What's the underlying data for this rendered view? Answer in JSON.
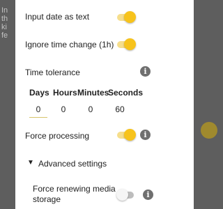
{
  "background": {
    "fragment_1": "In",
    "fragment_2": "th",
    "fragment_3": "ki",
    "fragment_4": "fe"
  },
  "settings": {
    "input_date_as_text": {
      "label": "Input date as text",
      "enabled": true
    },
    "ignore_time_change": {
      "label": "Ignore time change (1h)",
      "enabled": true
    },
    "time_tolerance": {
      "label": "Time tolerance",
      "columns": [
        "Days",
        "Hours",
        "Minutes",
        "Seconds"
      ],
      "values": [
        "0",
        "0",
        "0",
        "60"
      ]
    },
    "force_processing": {
      "label": "Force processing",
      "enabled": true
    },
    "advanced_settings": {
      "label": "Advanced settings",
      "expanded": true
    },
    "force_renewing_media_storage": {
      "label_line1": "Force renewing media",
      "label_line2": "storage",
      "enabled": false
    }
  },
  "colors": {
    "accent": "#f7c31c",
    "accent_track": "#f6de8c",
    "info_icon": "#6f6f6f",
    "scrim": "#5e5e5e"
  }
}
